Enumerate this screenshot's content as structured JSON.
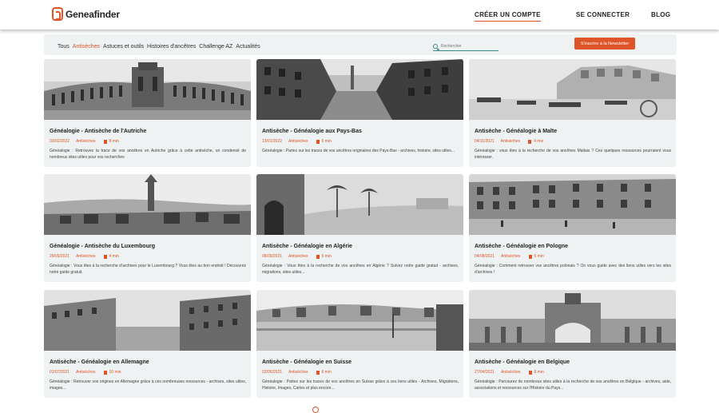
{
  "header": {
    "brand": "Geneafinder",
    "nav": [
      {
        "label": "CRÉER UN COMPTE"
      },
      {
        "label": "SE CONNECTER"
      },
      {
        "label": "BLOG"
      }
    ]
  },
  "filters": {
    "items": [
      {
        "label": "Tous"
      },
      {
        "label": "Antisèches"
      },
      {
        "label": "Astuces et outils"
      },
      {
        "label": "Histoires d'ancêtres"
      },
      {
        "label": "Challenge AZ"
      },
      {
        "label": "Actualités"
      }
    ],
    "active": "Antisèches",
    "search_placeholder": "Rechercher",
    "newsletter_label": "S'inscrire à la Newsletter"
  },
  "colors": {
    "accent": "#e0542a",
    "card_bg": "#eef2f2",
    "search_teal": "#3a8a86"
  },
  "cards": [
    {
      "title": "Généalogie - Antisèche de l'Autriche",
      "date": "03/02/2022",
      "category": "Antisèches",
      "read": "8 min",
      "desc": "Généalogie : Retrouvez la trace de vos ancêtres en Autriche grâce à cette antisèche, un condensé de nombreux sites utiles pour vos recherches"
    },
    {
      "title": "Antisèche - Généalogie aux Pays-Bas",
      "date": "13/01/2022",
      "category": "Antisèches",
      "read": "6 min",
      "desc": "Généalogie : Partez sur les traces de vos ancêtres originaires des Pays-Bas - archives, histoire, sites utiles..."
    },
    {
      "title": "Antisèche - Généalogie à Malte",
      "date": "04/11/2021",
      "category": "Antisèches",
      "read": "4 min",
      "desc": "Généalogie : vous êtes à la recherche de vos ancêtres Maltais ? Ces quelques ressources pourraient vous intéresser."
    },
    {
      "title": "Généalogie - Antisèche du Luxembourg",
      "date": "29/09/2021",
      "category": "Antisèches",
      "read": "4 min",
      "desc": "Généalogie : Vous êtes à la recherche d'archives pour le Luxembourg ? Vous êtes au bon endroit ! Découvrez notre guide gratuit."
    },
    {
      "title": "Antisèche - Généalogie en Algérie",
      "date": "08/09/2021",
      "category": "Antisèches",
      "read": "5 min",
      "desc": "Généalogie : Vous êtes à la recherche de vos ancêtres en Algérie ? Suivez notre guide gratuit - archives, migrations, sites utiles..."
    },
    {
      "title": "Antisèche - Généalogie en Pologne",
      "date": "04/08/2021",
      "category": "Antisèches",
      "read": "6 min",
      "desc": "Généalogie : Comment retrouver vos ancêtres polonais ? On vous guide avec des liens utiles vers les sites d'archives !"
    },
    {
      "title": "Antisèche - Généalogie en Allemagne",
      "date": "01/07/2021",
      "category": "Antisèches",
      "read": "10 min",
      "desc": "Généalogie : Retrouver vos origines en Allemagne grâce à ces nombreuses ressources - archives, sites utiles, images..."
    },
    {
      "title": "Antisèche - Généalogie en Suisse",
      "date": "02/06/2021",
      "category": "Antisèches",
      "read": "6 min",
      "desc": "Généalogie : Partez sur les traces de vos ancêtres en Suisse grâce à ces liens utiles - Archives, Migrations, Histoire, Images, Cartes et plus encore..."
    },
    {
      "title": "Antisèche - Généalogie en Belgique",
      "date": "27/04/2021",
      "category": "Antisèches",
      "read": "8 min",
      "desc": "Généalogie : Parcourez de nombreux sites utiles à la recherche de vos ancêtres en Belgique - archives, aide, associations et ressources sur l'Histoire du Pays..."
    }
  ]
}
